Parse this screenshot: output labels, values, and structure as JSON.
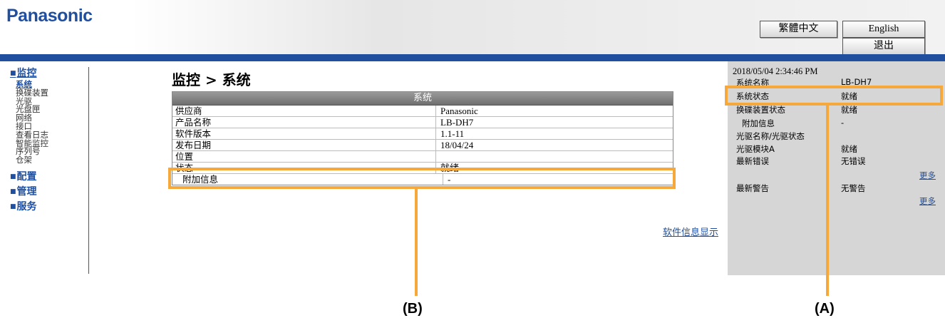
{
  "header": {
    "brand": "Panasonic",
    "lang_traditional_chinese": "繁體中文",
    "lang_english": "English",
    "logout": "退出"
  },
  "nav": {
    "monitor_label": "监控",
    "monitor_items": [
      "系统",
      "换碟装置",
      "光驱",
      "光盘匣",
      "网络",
      "接口",
      "查看日志",
      "智能监控",
      "序列号",
      "仓架"
    ],
    "config_label": "配置",
    "manage_label": "管理",
    "service_label": "服务"
  },
  "main": {
    "title": "监控 > 系统",
    "table_header": "系统",
    "rows": [
      {
        "label": "供应商",
        "value": "Panasonic"
      },
      {
        "label": "产品名称",
        "value": "LB-DH7"
      },
      {
        "label": "软件版本",
        "value": "1.1-11"
      },
      {
        "label": "发布日期",
        "value": "18/04/24"
      },
      {
        "label": "位置",
        "value": ""
      },
      {
        "label": "状态",
        "value": "就绪"
      },
      {
        "label": "附加信息",
        "value": "-"
      }
    ],
    "software_info_link": "软件信息显示"
  },
  "status_panel": {
    "datetime": "2018/05/04    2:34:46 PM",
    "system_name_label": "系统名称",
    "system_name_value": "LB-DH7",
    "system_status_label": "系统状态",
    "system_status_value": "就绪",
    "changer_status_label": "换碟装置状态",
    "changer_status_value": "就绪",
    "additional_info_label": "附加信息",
    "additional_info_value": "-",
    "drive_name_status_label": "光驱名称/光驱状态",
    "drive_module_label": "光驱模块A",
    "drive_module_value": "就绪",
    "latest_error_label": "最新错误",
    "latest_error_value": "无错误",
    "more_errors": "更多",
    "latest_warning_label": "最新警告",
    "latest_warning_value": "无警告",
    "more_warnings": "更多"
  },
  "callouts": {
    "a_label": "(A)",
    "b_label": "(B)"
  },
  "colors": {
    "brand_blue": "#1f4f9e",
    "highlight": "#f7a83a",
    "panel_gray": "#d6d6d6"
  }
}
